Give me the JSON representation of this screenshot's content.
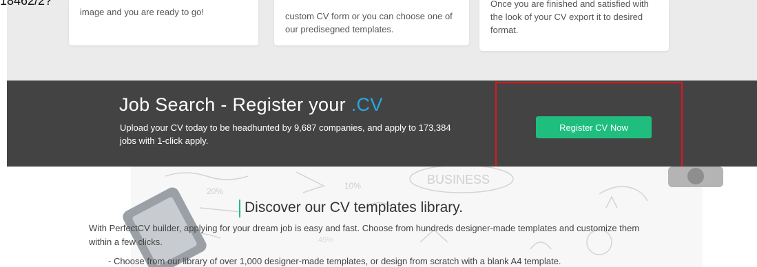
{
  "cropped_label": "18462/2?",
  "feature_cards": [
    {
      "text": "image and you are ready to go!"
    },
    {
      "text": "custom CV form or you can choose one of our predisegned templates."
    },
    {
      "text": "Once you are finished and satisfied with the look of your CV export it to desired format."
    }
  ],
  "job_banner": {
    "title_prefix": "Job Search - Register your ",
    "title_accent": ".CV",
    "description": "Upload your CV today to be headhunted by 9,687 companies, and apply to 173,384 jobs with 1-click apply.",
    "button_label": "Register CV Now"
  },
  "sketch_words": {
    "business": "BUSINESS",
    "percent_a": "20%",
    "percent_b": "10%",
    "percent_c": "45%"
  },
  "templates_section": {
    "title": "Discover our CV templates library.",
    "description": "With PerfectCV builder, applying for your dream job is easy and fast. Choose from hundreds designer-made templates and customize them within a few clicks.",
    "bullet": "- Choose from our library of over 1,000 designer-made templates, or design from scratch with a blank A4 template."
  },
  "colors": {
    "accent_blue": "#27a9e1",
    "button_green": "#1fbe7f",
    "banner_dark": "#434343",
    "highlight_red": "#e0161e"
  }
}
